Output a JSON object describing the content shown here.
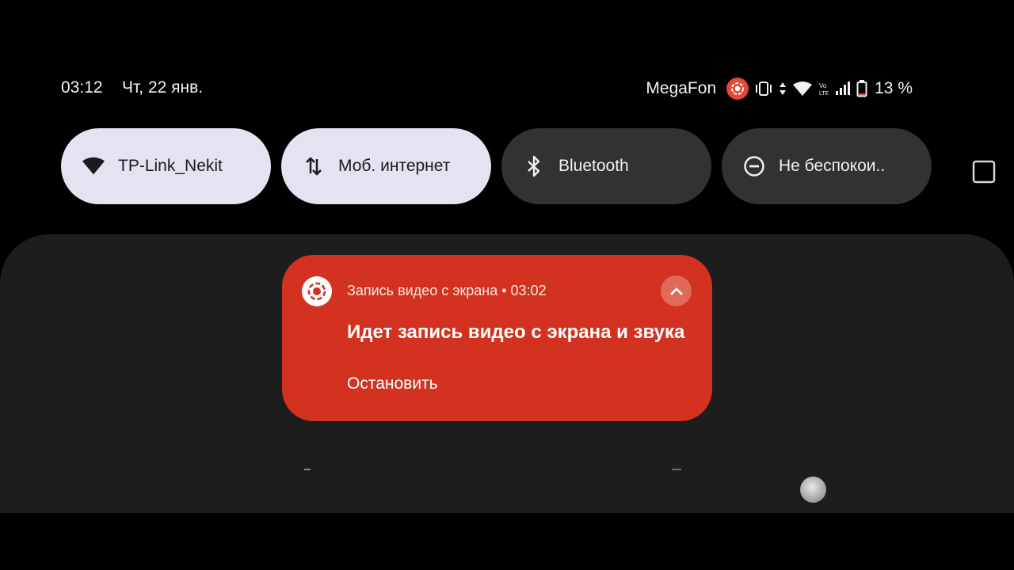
{
  "status_bar": {
    "time": "03:12",
    "date": "Чт, 22 янв.",
    "carrier": "MegaFon",
    "battery": "13 %",
    "icons": [
      "screen-record-icon",
      "vibrate-icon",
      "data-arrows-icon",
      "wifi-icon",
      "volte-icon",
      "signal-icon",
      "battery-icon"
    ]
  },
  "quick_tiles": [
    {
      "label": "TP-Link_Nekit",
      "icon": "wifi-icon",
      "state": "on"
    },
    {
      "label": "Моб. интернет",
      "icon": "mobile-data-icon",
      "state": "on"
    },
    {
      "label": "Bluetooth",
      "icon": "bluetooth-icon",
      "state": "off"
    },
    {
      "label": "Не беспокои..",
      "icon": "do-not-disturb-icon",
      "state": "off"
    }
  ],
  "notification": {
    "app_name": "Запись видео с экрана",
    "separator": "•",
    "elapsed": "03:02",
    "header": "Запись видео с экрана • 03:02",
    "title": "Идет запись видео с экрана и звука",
    "action": "Остановить",
    "color": "#d2321f"
  },
  "nav": [
    "recents-button",
    "home-button",
    "back-button"
  ],
  "colors": {
    "tile_on": "#e6e2f1",
    "tile_off": "#323232",
    "shade": "#1d1d1d",
    "record": "#e4483a"
  }
}
